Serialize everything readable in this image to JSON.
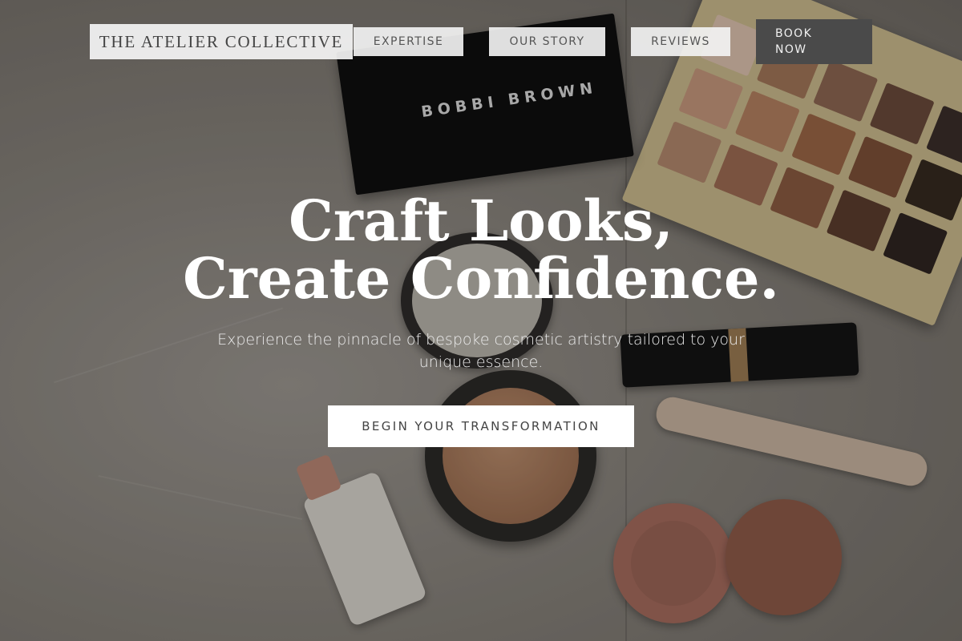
{
  "header": {
    "logo": "THE ATELIER COLLECTIVE",
    "nav": {
      "expertise": "EXPERTISE",
      "our_story": "OUR STORY",
      "reviews": "REVIEWS",
      "book_now_line1": "BOOK",
      "book_now_line2": "NOW"
    }
  },
  "hero": {
    "headline_line1": "Craft Looks,",
    "headline_line2": "Create Confidence.",
    "subtext": "Experience the pinnacle of bespoke cosmetic artistry tailored to your unique essence.",
    "cta": "BEGIN YOUR TRANSFORMATION",
    "background_product_brand": "BOBBI BROWN"
  },
  "colors": {
    "overlay": "#00000038",
    "cta_background": "#ffffff",
    "book_button": "#4a4a4a",
    "headline_text": "#ffffff"
  }
}
